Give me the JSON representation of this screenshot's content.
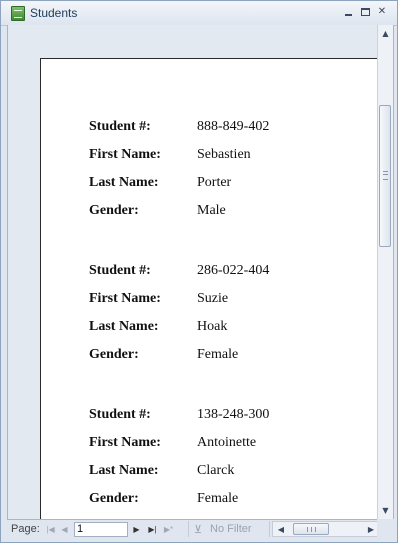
{
  "window": {
    "title": "Students"
  },
  "records": [
    {
      "student_label": "Student #:",
      "student_value": "888-849-402",
      "first_label": "First Name:",
      "first_value": "Sebastien",
      "last_label": "Last Name:",
      "last_value": "Porter",
      "gender_label": "Gender:",
      "gender_value": "Male"
    },
    {
      "student_label": "Student #:",
      "student_value": "286-022-404",
      "first_label": "First Name:",
      "first_value": "Suzie",
      "last_label": "Last Name:",
      "last_value": "Hoak",
      "gender_label": "Gender:",
      "gender_value": "Female"
    },
    {
      "student_label": "Student #:",
      "student_value": "138-248-300",
      "first_label": "First Name:",
      "first_value": "Antoinette",
      "last_label": "Last Name:",
      "last_value": "Clarck",
      "gender_label": "Gender:",
      "gender_value": "Female"
    }
  ],
  "statusbar": {
    "page_label": "Page:",
    "page_value": "1",
    "filter_label": "No Filter"
  },
  "icons": {
    "app": "access-report-icon",
    "first": "first-page-icon",
    "prev": "prev-page-icon",
    "next": "next-page-icon",
    "last": "last-page-icon",
    "filter": "funnel-icon"
  }
}
